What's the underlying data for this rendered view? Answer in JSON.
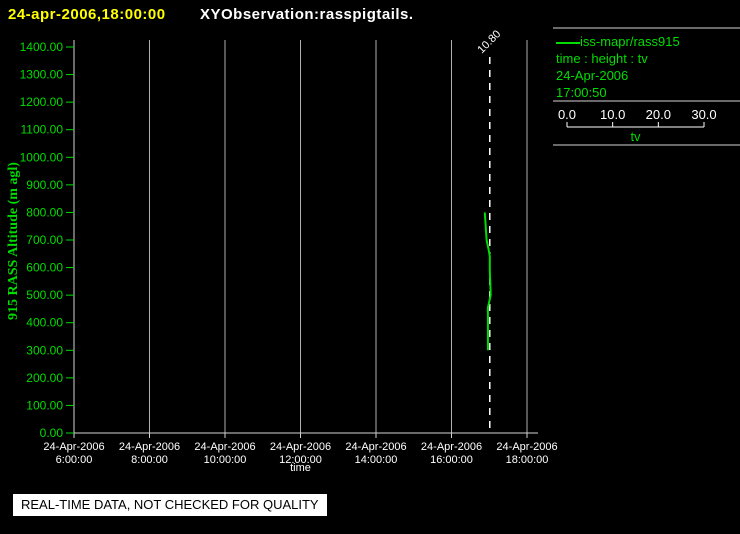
{
  "header": {
    "datetime": "24-apr-2006,18:00:00",
    "title": "XYObservation:rasspigtails."
  },
  "colors": {
    "background": "#000000",
    "text_green": "#00dd00",
    "title_yellow": "#ffff00",
    "text_white": "#ffffff",
    "grid_gray": "#b0b0b0",
    "axis_gray": "#d4d4d4",
    "series_green": "#00dd00"
  },
  "chart_data": {
    "type": "line",
    "title": "XYObservation:rasspigtails.",
    "xlabel": "time",
    "ylabel": "915 RASS Altitude (m agl)",
    "ylim": [
      0,
      1400
    ],
    "ytick_labels": [
      "0.00",
      "100.00",
      "200.00",
      "300.00",
      "400.00",
      "500.00",
      "600.00",
      "700.00",
      "800.00",
      "900.00",
      "1000.00",
      "1100.00",
      "1200.00",
      "1300.00",
      "1400.00"
    ],
    "x_date_label": "24-Apr-2006",
    "xtick_times": [
      "6:00:00",
      "8:00:00",
      "10:00:00",
      "12:00:00",
      "14:00:00",
      "16:00:00",
      "18:00:00"
    ],
    "grid": true,
    "cursor": {
      "value_label": "10.80",
      "style": "dashed"
    },
    "tv_axis": {
      "label": "tv",
      "tick_labels": [
        "0.0",
        "10.0",
        "20.0",
        "30.0"
      ],
      "range": [
        0,
        30
      ]
    },
    "series": [
      {
        "name": "iss-mapr/rass915",
        "relation": "time : height : tv",
        "profile_date": "24-Apr-2006",
        "profile_time": "17:00:50",
        "points_height_tv": [
          [
            800,
            9.7
          ],
          [
            750,
            9.9
          ],
          [
            700,
            10.1
          ],
          [
            660,
            10.6
          ],
          [
            640,
            10.8
          ],
          [
            590,
            10.8
          ],
          [
            500,
            11.0
          ],
          [
            455,
            10.4
          ],
          [
            300,
            10.4
          ]
        ]
      }
    ]
  },
  "legend": {
    "series_label": "iss-mapr/rass915",
    "relation": "time : height : tv",
    "date": "24-Apr-2006",
    "time": "17:00:50"
  },
  "footer": {
    "quality_banner": "REAL-TIME DATA, NOT CHECKED FOR QUALITY"
  }
}
